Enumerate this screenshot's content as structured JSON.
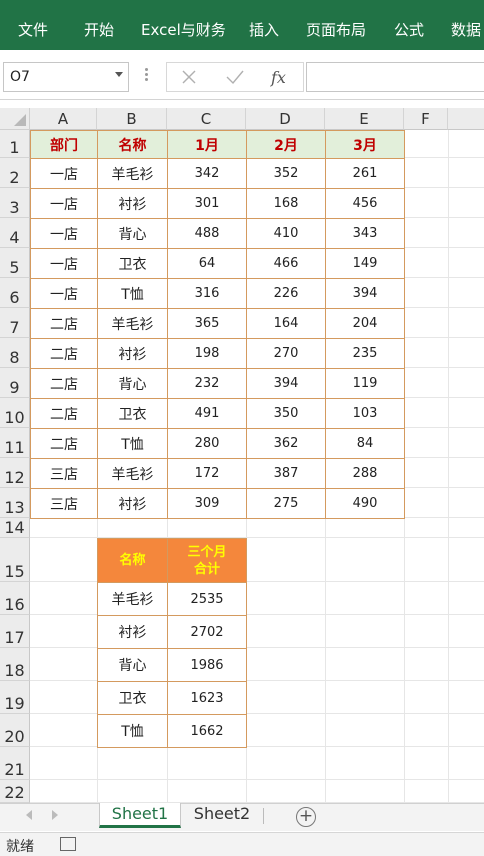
{
  "ribbon": {
    "tabs": [
      "文件",
      "开始",
      "Excel与财务",
      "插入",
      "页面布局",
      "公式",
      "数据"
    ]
  },
  "formula_bar": {
    "name_box": "O7",
    "icons": [
      "cancel-icon",
      "confirm-icon",
      "fx-icon"
    ],
    "value": ""
  },
  "columns": [
    "A",
    "B",
    "C",
    "D",
    "E",
    "F"
  ],
  "rows": [
    "1",
    "2",
    "3",
    "4",
    "5",
    "6",
    "7",
    "8",
    "9",
    "10",
    "11",
    "12",
    "13",
    "14",
    "15",
    "16",
    "17",
    "18",
    "19",
    "20",
    "21",
    "22"
  ],
  "table1": {
    "header": [
      "部门",
      "名称",
      "1月",
      "2月",
      "3月"
    ],
    "rows": [
      [
        "一店",
        "羊毛衫",
        "342",
        "352",
        "261"
      ],
      [
        "一店",
        "衬衫",
        "301",
        "168",
        "456"
      ],
      [
        "一店",
        "背心",
        "488",
        "410",
        "343"
      ],
      [
        "一店",
        "卫衣",
        "64",
        "466",
        "149"
      ],
      [
        "一店",
        "T恤",
        "316",
        "226",
        "394"
      ],
      [
        "二店",
        "羊毛衫",
        "365",
        "164",
        "204"
      ],
      [
        "二店",
        "衬衫",
        "198",
        "270",
        "235"
      ],
      [
        "二店",
        "背心",
        "232",
        "394",
        "119"
      ],
      [
        "二店",
        "卫衣",
        "491",
        "350",
        "103"
      ],
      [
        "二店",
        "T恤",
        "280",
        "362",
        "84"
      ],
      [
        "三店",
        "羊毛衫",
        "172",
        "387",
        "288"
      ],
      [
        "三店",
        "衬衫",
        "309",
        "275",
        "490"
      ]
    ],
    "header_bg": "#e2efda",
    "header_color": "#c00000",
    "border_color": "#d49a5e"
  },
  "table2": {
    "header": [
      "名称",
      "三个月",
      "合计"
    ],
    "rows": [
      [
        "羊毛衫",
        "2535"
      ],
      [
        "衬衫",
        "2702"
      ],
      [
        "背心",
        "1986"
      ],
      [
        "卫衣",
        "1623"
      ],
      [
        "T恤",
        "1662"
      ]
    ],
    "header_bg": "#f4873c",
    "header_color": "#ffff00"
  },
  "sheets": {
    "tabs": [
      "Sheet1",
      "Sheet2"
    ],
    "active": "Sheet1"
  },
  "status": {
    "text": "就绪"
  },
  "colors": {
    "brand": "#217346"
  }
}
